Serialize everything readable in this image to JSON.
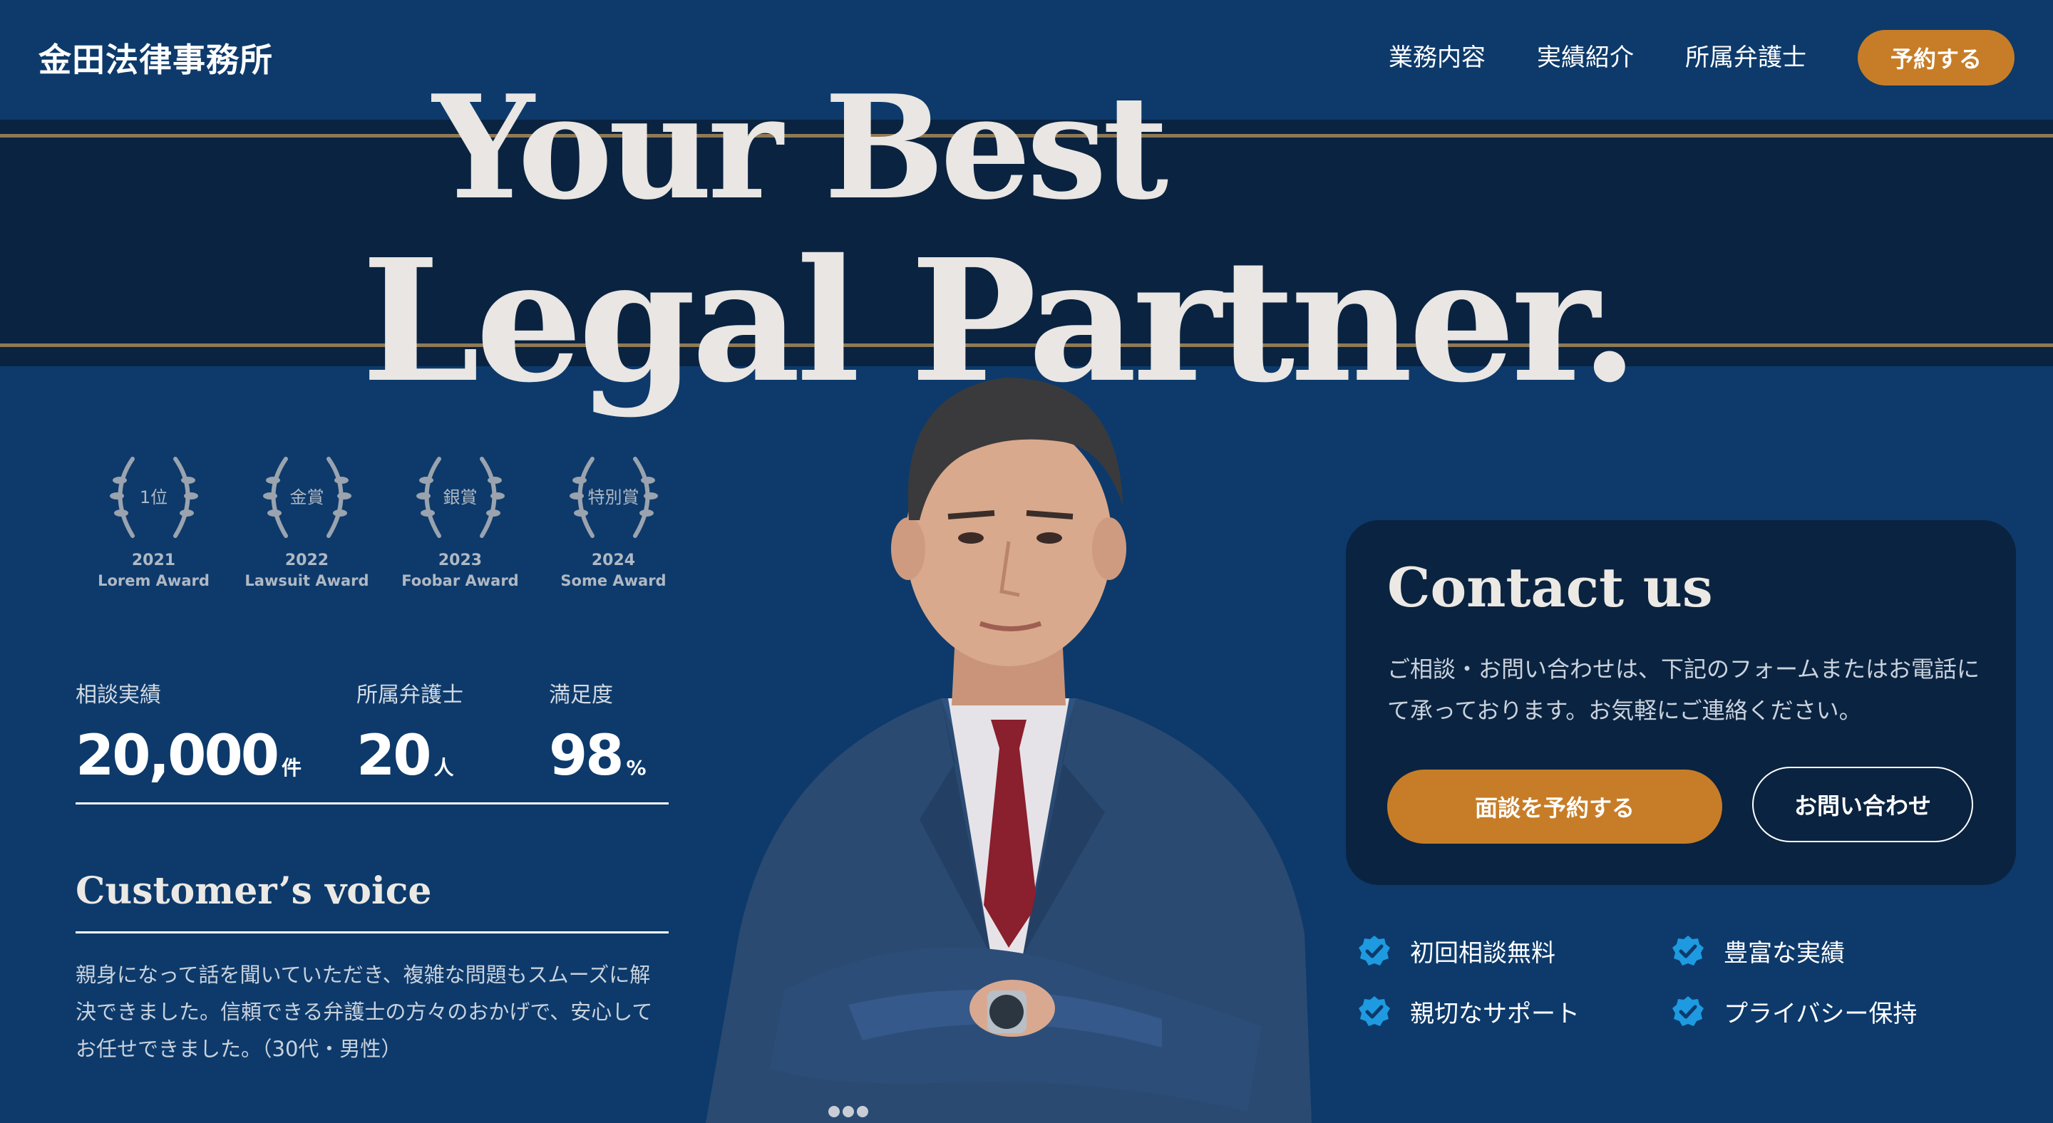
{
  "header": {
    "logo": "金田法律事務所",
    "nav": [
      "業務内容",
      "実績紹介",
      "所属弁護士"
    ],
    "cta": "予約する"
  },
  "hero": {
    "line1": "Your Best",
    "line2": "Legal Partner."
  },
  "awards": [
    {
      "badge": "1位",
      "year": "2021",
      "name": "Lorem Award"
    },
    {
      "badge": "金賞",
      "year": "2022",
      "name": "Lawsuit Award"
    },
    {
      "badge": "銀賞",
      "year": "2023",
      "name": "Foobar Award"
    },
    {
      "badge": "特別賞",
      "year": "2024",
      "name": "Some Award"
    }
  ],
  "stats": [
    {
      "label": "相談実績",
      "value": "20,000",
      "unit": "件"
    },
    {
      "label": "所属弁護士",
      "value": "20",
      "unit": "人"
    },
    {
      "label": "満足度",
      "value": "98",
      "unit": "%"
    }
  ],
  "voice": {
    "title": "Customer’s voice",
    "text": "親身になって話を聞いていただき、複雑な問題もスムーズに解決できました。信頼できる弁護士の方々のおかげで、安心してお任せできました。（30代・男性）"
  },
  "contact": {
    "title": "Contact us",
    "text": "ご相談・お問い合わせは、下記のフォームまたはお電話にて承っております。お気軽にご連絡ください。",
    "primary": "面談を予約する",
    "secondary": "お問い合わせ"
  },
  "features": [
    "初回相談無料",
    "豊富な実績",
    "親切なサポート",
    "プライバシー保持"
  ],
  "colors": {
    "background": "#0d3a6b",
    "band": "#0a2340",
    "accent": "#c77d27",
    "check": "#1e9ae0"
  }
}
